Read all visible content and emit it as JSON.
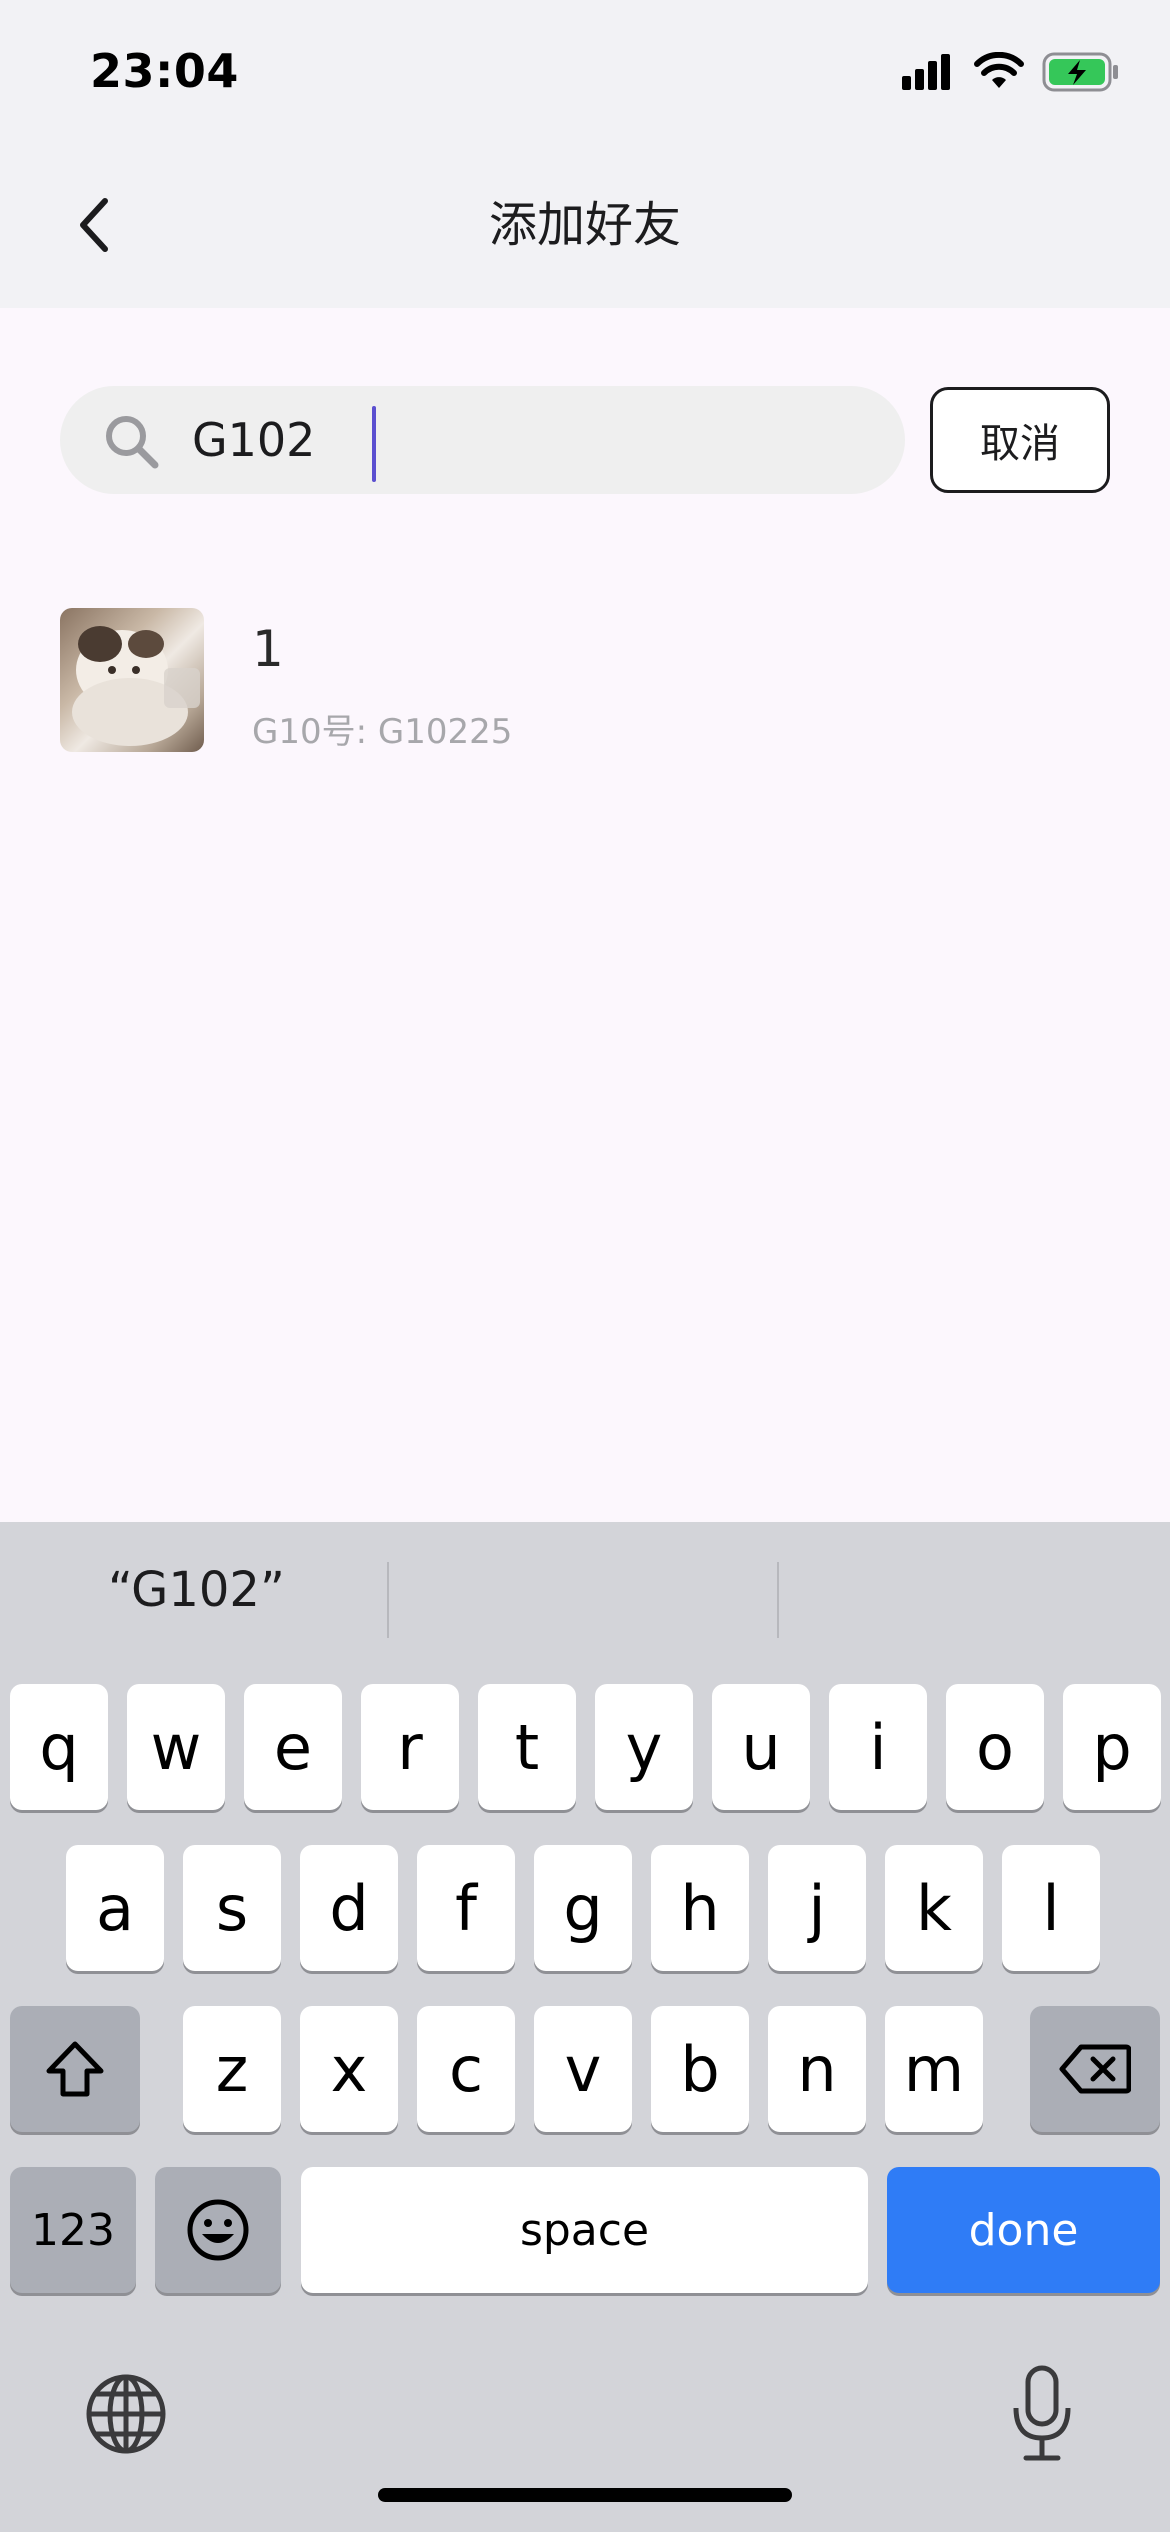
{
  "status_bar": {
    "time": "23:04"
  },
  "nav": {
    "title": "添加好友"
  },
  "search": {
    "value": "G102",
    "cancel_label": "取消"
  },
  "results": [
    {
      "name": "1",
      "id_text": "G10号: G10225"
    }
  ],
  "keyboard": {
    "suggestion": "“G102”",
    "rows": [
      [
        "q",
        "w",
        "e",
        "r",
        "t",
        "y",
        "u",
        "i",
        "o",
        "p"
      ],
      [
        "a",
        "s",
        "d",
        "f",
        "g",
        "h",
        "j",
        "k",
        "l"
      ],
      [
        "z",
        "x",
        "c",
        "v",
        "b",
        "n",
        "m"
      ]
    ],
    "numbers_label": "123",
    "space_label": "space",
    "done_label": "done"
  },
  "colors": {
    "accent_done": "#2f7cf6",
    "caret": "#5b4fd0",
    "battery_green": "#35c759"
  }
}
